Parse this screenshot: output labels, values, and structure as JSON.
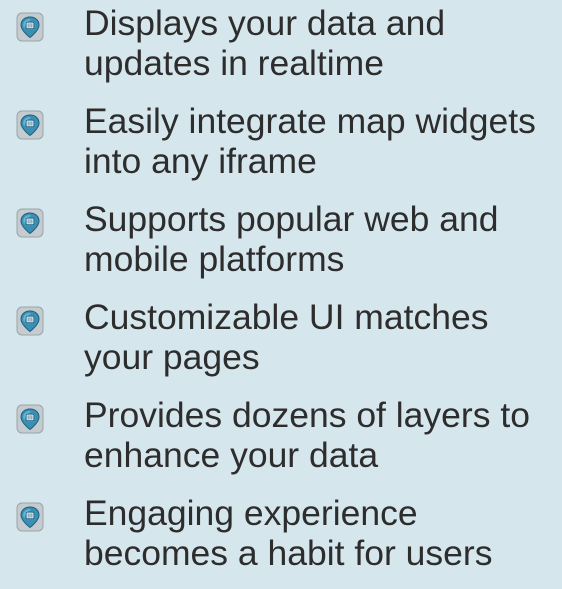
{
  "features": {
    "items": [
      {
        "icon": "map-pin-icon",
        "text": "Displays your data and\nupdates in realtime"
      },
      {
        "icon": "map-pin-icon",
        "text": "Easily integrate map widgets\ninto any iframe"
      },
      {
        "icon": "map-pin-icon",
        "text": "Supports popular web and\nmobile platforms"
      },
      {
        "icon": "map-pin-icon",
        "text": "Customizable UI matches\nyour pages"
      },
      {
        "icon": "map-pin-icon",
        "text": "Provides dozens of layers to\nenhance your data"
      },
      {
        "icon": "map-pin-icon",
        "text": "Engaging experience\nbecomes a habit for users"
      }
    ]
  },
  "colors": {
    "background": "#d6e6ed",
    "text": "#2d2d2d",
    "icon_blue": "#3a8fb5",
    "icon_light": "#6cc0e0",
    "icon_frame": "#a8b1b6"
  }
}
